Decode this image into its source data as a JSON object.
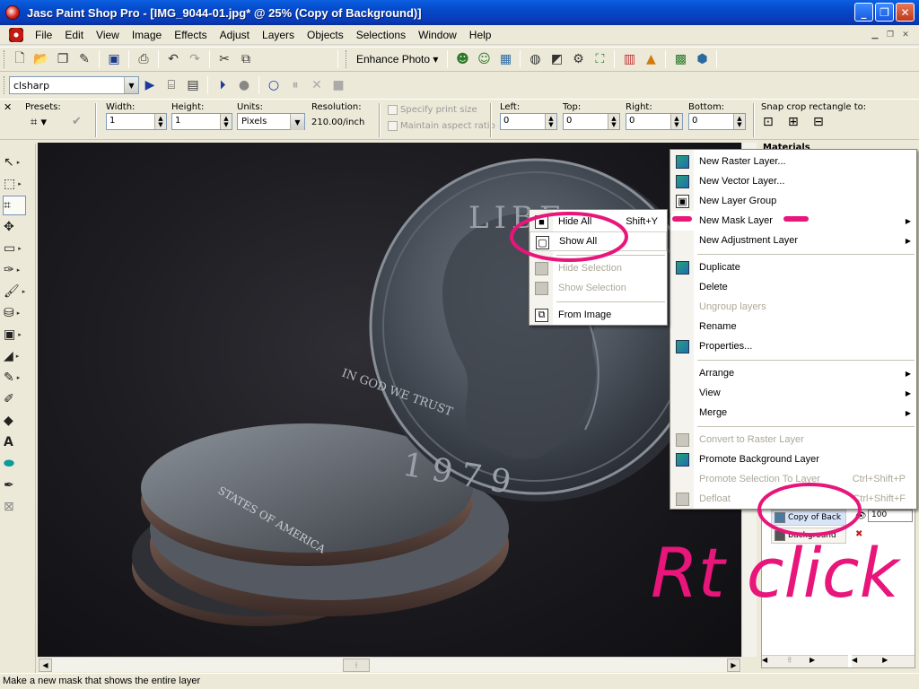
{
  "window": {
    "title": "Jasc Paint Shop Pro - [IMG_9044-01.jpg* @  25% (Copy of Background)]",
    "controls": [
      "_",
      "❐",
      "✕"
    ]
  },
  "menubar": {
    "items": [
      "File",
      "Edit",
      "View",
      "Image",
      "Effects",
      "Adjust",
      "Layers",
      "Objects",
      "Selections",
      "Window",
      "Help"
    ]
  },
  "toolbar": {
    "enhance_photo": "Enhance Photo ▾"
  },
  "script_toolbar": {
    "script_name": "clsharp"
  },
  "tool_options": {
    "presets_label": "Presets:",
    "width_label": "Width:",
    "width_value": "1",
    "height_label": "Height:",
    "height_value": "1",
    "units_label": "Units:",
    "units_value": "Pixels",
    "resolution_label": "Resolution:",
    "resolution_value": "210.00/inch",
    "specify_print_size": "Specify print size",
    "maintain_aspect": "Maintain aspect ratio",
    "left_label": "Left:",
    "left_value": "0",
    "top_label": "Top:",
    "top_value": "0",
    "right_label": "Right:",
    "right_value": "0",
    "bottom_label": "Bottom:",
    "bottom_value": "0",
    "snap_label": "Snap crop rectangle to:"
  },
  "palette": {
    "materials_label": "Materials",
    "layers": [
      {
        "name": "Copy of Back",
        "selected": true
      },
      {
        "name": "Background",
        "selected": false
      }
    ],
    "opacity": "100"
  },
  "layers_menu": {
    "items": [
      {
        "label": "New Raster Layer...",
        "disabled": false,
        "submenu": false,
        "shortcut": ""
      },
      {
        "label": "New Vector Layer...",
        "disabled": false,
        "submenu": false,
        "shortcut": ""
      },
      {
        "label": "New Layer Group",
        "disabled": false,
        "submenu": false,
        "shortcut": ""
      },
      {
        "label": "New Mask Layer",
        "disabled": false,
        "submenu": true,
        "shortcut": ""
      },
      {
        "label": "New Adjustment Layer",
        "disabled": false,
        "submenu": true,
        "shortcut": ""
      },
      {
        "label": "Duplicate",
        "disabled": false,
        "submenu": false,
        "shortcut": ""
      },
      {
        "label": "Delete",
        "disabled": false,
        "submenu": false,
        "shortcut": ""
      },
      {
        "label": "Ungroup layers",
        "disabled": true,
        "submenu": false,
        "shortcut": ""
      },
      {
        "label": "Rename",
        "disabled": false,
        "submenu": false,
        "shortcut": ""
      },
      {
        "label": "Properties...",
        "disabled": false,
        "submenu": false,
        "shortcut": ""
      },
      {
        "label": "Arrange",
        "disabled": false,
        "submenu": true,
        "shortcut": ""
      },
      {
        "label": "View",
        "disabled": false,
        "submenu": true,
        "shortcut": ""
      },
      {
        "label": "Merge",
        "disabled": false,
        "submenu": true,
        "shortcut": ""
      },
      {
        "label": "Convert to Raster Layer",
        "disabled": true,
        "submenu": false,
        "shortcut": ""
      },
      {
        "label": "Promote Background Layer",
        "disabled": false,
        "submenu": false,
        "shortcut": ""
      },
      {
        "label": "Promote Selection To Layer",
        "disabled": true,
        "submenu": false,
        "shortcut": "Ctrl+Shift+P"
      },
      {
        "label": "Defloat",
        "disabled": true,
        "submenu": false,
        "shortcut": "Ctrl+Shift+F"
      }
    ]
  },
  "mask_submenu": {
    "items": [
      {
        "label": "Hide All",
        "disabled": false,
        "shortcut": "Shift+Y"
      },
      {
        "label": "Show All",
        "disabled": false,
        "shortcut": ""
      },
      {
        "label": "Hide Selection",
        "disabled": true,
        "shortcut": ""
      },
      {
        "label": "Show Selection",
        "disabled": true,
        "shortcut": ""
      },
      {
        "label": "From Image",
        "disabled": false,
        "shortcut": ""
      }
    ]
  },
  "coin": {
    "top_text": "LIBE",
    "motto": "IN GOD WE TRUST",
    "year": "1979",
    "edge_text": "STATES OF AMERICA"
  },
  "annotation": {
    "text": "Rt click",
    "color": "#e8157a"
  },
  "statusbar": {
    "text": "Make a new mask that shows the entire layer"
  }
}
